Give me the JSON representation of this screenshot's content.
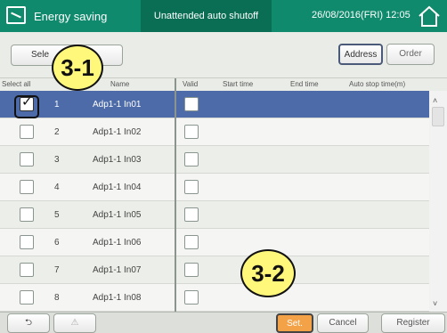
{
  "header": {
    "title": "Energy saving",
    "mode": "Unattended auto shutoff",
    "datetime": "26/08/2016(FRI) 12:05",
    "icons": {
      "app": "energy-saving-icon",
      "home": "home-icon"
    },
    "colors": {
      "bar": "#0f8a6c",
      "mode_bg": "#0a6e55"
    }
  },
  "toolbar": {
    "select_all_label": "Select all",
    "select_all_visible": "Sele",
    "select_all_visible_end": "all",
    "address_label": "Address",
    "order_label": "Order"
  },
  "columns": {
    "select": "Select all",
    "name": "Name",
    "valid": "Valid",
    "start_time": "Start time",
    "end_time": "End time",
    "auto_stop_time": "Auto stop time(m)"
  },
  "rows": [
    {
      "num": "1",
      "name": "Adp1-1 In01",
      "selected": true,
      "valid": false
    },
    {
      "num": "2",
      "name": "Adp1-1 In02",
      "selected": false,
      "valid": false
    },
    {
      "num": "3",
      "name": "Adp1-1 In03",
      "selected": false,
      "valid": false
    },
    {
      "num": "4",
      "name": "Adp1-1 In04",
      "selected": false,
      "valid": false
    },
    {
      "num": "5",
      "name": "Adp1-1 In05",
      "selected": false,
      "valid": false
    },
    {
      "num": "6",
      "name": "Adp1-1 In06",
      "selected": false,
      "valid": false
    },
    {
      "num": "7",
      "name": "Adp1-1 In07",
      "selected": false,
      "valid": false
    },
    {
      "num": "8",
      "name": "Adp1-1 In08",
      "selected": false,
      "valid": false
    }
  ],
  "footer": {
    "set_label": "Set.",
    "cancel_label": "Cancel",
    "register_label": "Register",
    "icons": {
      "back": "back-arrow-icon",
      "warning": "warning-icon"
    },
    "colors": {
      "set": "#f3a247",
      "selected_row": "#4d6ba9"
    }
  },
  "callouts": {
    "step1": "3-1",
    "step2": "3-2"
  },
  "glyphs": {
    "check": "✓",
    "back": "⮌",
    "warning": "⚠",
    "scroll_up": "˄",
    "scroll_down": "˅"
  }
}
